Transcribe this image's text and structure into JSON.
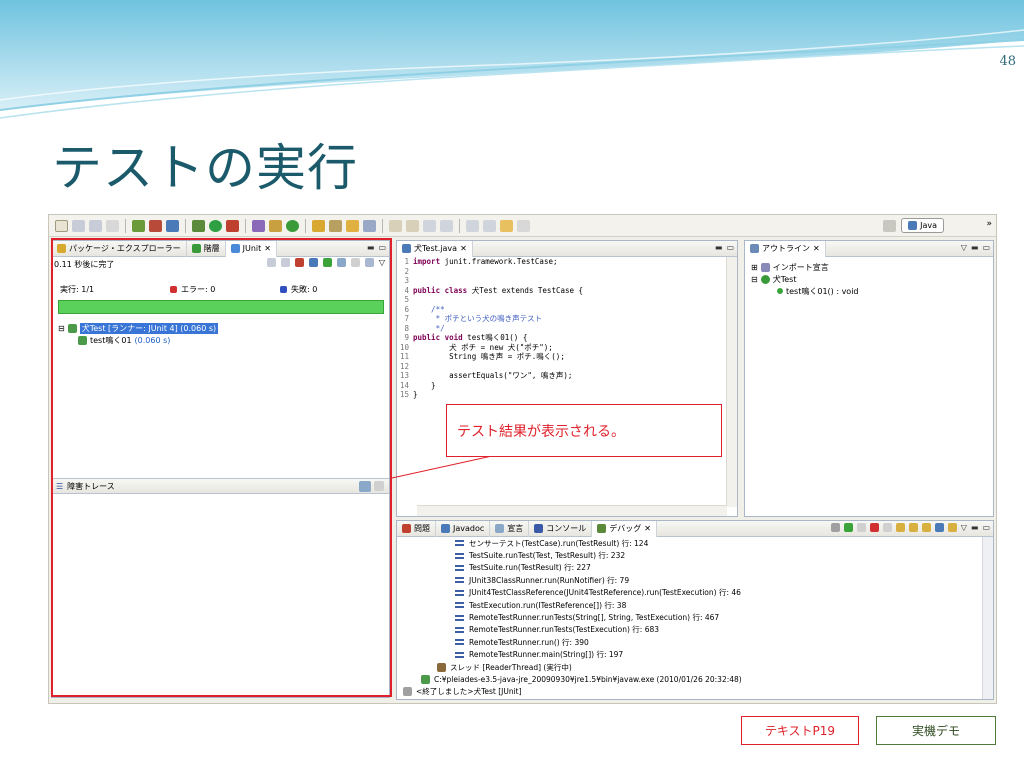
{
  "slide": {
    "number": "48",
    "title": "テストの実行",
    "callout": "テスト結果が表示される。",
    "buttons": {
      "text_ref": "テキストP19",
      "demo": "実機デモ"
    }
  },
  "colors": {
    "title": "#1b5a6b",
    "accent_red": "#e0212b",
    "junit_green": "#5ad15a",
    "demo_green": "#4e7a3a"
  },
  "eclipse": {
    "perspective": "Java",
    "junit_panel": {
      "tabs": [
        "パッケージ・エクスプローラー",
        "階層",
        "JUnit"
      ],
      "status": "0.11 秒後に完了",
      "runs_label": "実行: 1/1",
      "errors_label": "エラー: 0",
      "failures_label": "失敗: 0",
      "progress": 1.0,
      "tree": {
        "suite": "犬Test [ランナー: JUnit 4] (0.060 s)",
        "case_name": "test鳴く01",
        "case_time": "(0.060 s)"
      },
      "failure_trace": "障害トレース"
    },
    "editor": {
      "tab": "犬Test.java",
      "lines": [
        {
          "n": "1",
          "kw": "import",
          "rest": " junit.framework.TestCase;"
        },
        {
          "n": "2",
          "kw": "",
          "rest": ""
        },
        {
          "n": "3",
          "kw": "",
          "rest": ""
        },
        {
          "n": "4",
          "kw": "public class",
          "rest": " 犬Test extends TestCase {"
        },
        {
          "n": "5",
          "kw": "",
          "rest": ""
        },
        {
          "n": "6",
          "kw": "",
          "rest": "    /**"
        },
        {
          "n": "7",
          "kw": "",
          "rest": "     * ポチという犬の鳴き声テスト"
        },
        {
          "n": "8",
          "kw": "",
          "rest": "     */"
        },
        {
          "n": "9",
          "kw": "public void",
          "rest": " test鳴く01() {"
        },
        {
          "n": "10",
          "kw": "",
          "rest": "        犬 ポチ = new 犬(\"ポチ\");"
        },
        {
          "n": "11",
          "kw": "",
          "rest": "        String 鳴き声 = ポチ.鳴く();"
        },
        {
          "n": "12",
          "kw": "",
          "rest": ""
        },
        {
          "n": "13",
          "kw": "",
          "rest": "        assertEquals(\"ワン\", 鳴き声);"
        },
        {
          "n": "14",
          "kw": "",
          "rest": "    }"
        },
        {
          "n": "15",
          "kw": "",
          "rest": "}"
        }
      ]
    },
    "outline": {
      "tab": "アウトライン",
      "items": [
        "インポート宣言",
        "犬Test",
        "test鳴く01() : void"
      ]
    },
    "console": {
      "tabs": [
        "問題",
        "Javadoc",
        "宣言",
        "コンソール",
        "デバッグ"
      ],
      "frames": [
        "センサーテスト(TestCase).run(TestResult) 行: 124",
        "TestSuite.runTest(Test, TestResult) 行: 232",
        "TestSuite.run(TestResult) 行: 227",
        "JUnit38ClassRunner.run(RunNotifier) 行: 79",
        "JUnit4TestClassReference(JUnit4TestReference).run(TestExecution) 行: 46",
        "TestExecution.run(ITestReference[]) 行: 38",
        "RemoteTestRunner.runTests(String[], String, TestExecution) 行: 467",
        "RemoteTestRunner.runTests(TestExecution) 行: 683",
        "RemoteTestRunner.run() 行: 390",
        "RemoteTestRunner.main(String[]) 行: 197"
      ],
      "thread": "スレッド [ReaderThread] (実行中)",
      "process": "C:¥pleiades-e3.5-java-jre_20090930¥jre1.5¥bin¥javaw.exe (2010/01/26 20:32:48)",
      "terminated": "<終了しました>犬Test [JUnit]"
    }
  }
}
